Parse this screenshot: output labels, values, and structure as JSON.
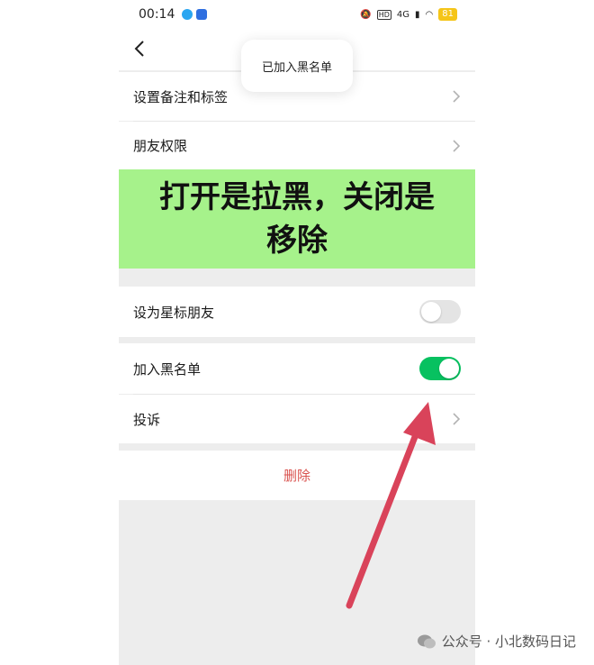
{
  "statusbar": {
    "time": "00:14",
    "battery": "81",
    "network": "4G",
    "hd": "HD"
  },
  "toast": {
    "text": "已加入黑名单"
  },
  "rows": {
    "remark": "设置备注和标签",
    "permissions": "朋友权限",
    "star": "设为星标朋友",
    "blacklist": "加入黑名单",
    "complaint": "投诉",
    "delete": "删除"
  },
  "toggles": {
    "star": false,
    "blacklist": true
  },
  "banner": {
    "line1": "打开是拉黑，关闭是",
    "line2": "移除"
  },
  "watermark": {
    "text": "公众号 · 小北数码日记"
  },
  "colors": {
    "accent": "#07c160",
    "danger": "#d9534f",
    "banner": "#a6f28b",
    "arrow": "#d9435a"
  }
}
